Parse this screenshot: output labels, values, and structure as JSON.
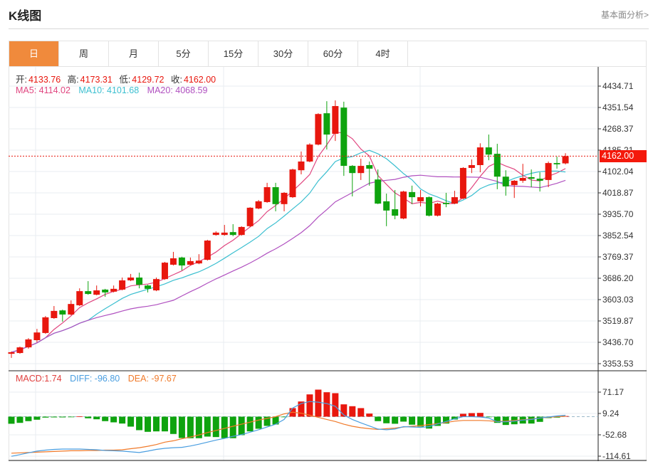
{
  "header": {
    "title": "K线图",
    "link": "基本面分析>"
  },
  "tabs": [
    {
      "label": "日",
      "active": true
    },
    {
      "label": "周"
    },
    {
      "label": "月"
    },
    {
      "label": "5分"
    },
    {
      "label": "15分"
    },
    {
      "label": "30分"
    },
    {
      "label": "60分"
    },
    {
      "label": "4时"
    }
  ],
  "legend": {
    "open_label": "开:",
    "open": "4133.76",
    "high_label": "高:",
    "high": "4173.31",
    "low_label": "低:",
    "low": "4129.72",
    "close_label": "收:",
    "close": "4162.00",
    "ma5": "MA5: 4114.02",
    "ma10": "MA10: 4101.68",
    "ma20": "MA20: 4068.59"
  },
  "macd_legend": {
    "macd": "MACD:1.74",
    "diff": "DIFF: -96.80",
    "dea": "DEA: -97.67"
  },
  "current_price": "4162.00",
  "colors": {
    "up": "#e8170e",
    "down": "#0ea30e",
    "ma5": "#e0457f",
    "ma10": "#3bbfd0",
    "ma20": "#b050c0",
    "diff": "#4a9ee0",
    "dea": "#f07a2a",
    "active_tab": "#f08a3c"
  },
  "chart_data": [
    {
      "type": "candlestick",
      "yticks": [
        "4434.71",
        "4351.54",
        "4268.37",
        "4185.21",
        "4102.04",
        "4018.87",
        "3935.70",
        "3852.54",
        "3769.37",
        "3686.20",
        "3603.03",
        "3519.87",
        "3436.70",
        "3353.53"
      ],
      "ylim": [
        3353.53,
        4434.71
      ],
      "ohlc": [
        [
          3392,
          3401,
          3376,
          3398
        ],
        [
          3395,
          3420,
          3392,
          3417
        ],
        [
          3417,
          3453,
          3412,
          3448
        ],
        [
          3445,
          3489,
          3437,
          3475
        ],
        [
          3473,
          3539,
          3470,
          3534
        ],
        [
          3531,
          3578,
          3528,
          3559
        ],
        [
          3561,
          3564,
          3517,
          3545
        ],
        [
          3545,
          3600,
          3542,
          3586
        ],
        [
          3581,
          3647,
          3578,
          3636
        ],
        [
          3636,
          3675,
          3622,
          3625
        ],
        [
          3622,
          3658,
          3620,
          3639
        ],
        [
          3642,
          3645,
          3614,
          3631
        ],
        [
          3634,
          3658,
          3631,
          3645
        ],
        [
          3642,
          3689,
          3639,
          3678
        ],
        [
          3678,
          3703,
          3675,
          3689
        ],
        [
          3689,
          3708,
          3647,
          3661
        ],
        [
          3658,
          3661,
          3631,
          3645
        ],
        [
          3639,
          3689,
          3636,
          3683
        ],
        [
          3683,
          3750,
          3680,
          3747
        ],
        [
          3739,
          3789,
          3736,
          3764
        ],
        [
          3767,
          3770,
          3717,
          3736
        ],
        [
          3739,
          3767,
          3736,
          3753
        ],
        [
          3744,
          3780,
          3741,
          3755
        ],
        [
          3758,
          3836,
          3755,
          3833
        ],
        [
          3855,
          3869,
          3852,
          3864
        ],
        [
          3855,
          3894,
          3852,
          3864
        ],
        [
          3866,
          3897,
          3850,
          3855
        ],
        [
          3855,
          3889,
          3852,
          3886
        ],
        [
          3889,
          3963,
          3886,
          3961
        ],
        [
          3958,
          3991,
          3955,
          3986
        ],
        [
          3983,
          4058,
          3980,
          4041
        ],
        [
          4041,
          4058,
          3947,
          3975
        ],
        [
          3975,
          4022,
          3947,
          4019
        ],
        [
          4002,
          4113,
          3999,
          4110
        ],
        [
          4107,
          4180,
          4091,
          4141
        ],
        [
          4141,
          4212,
          4138,
          4207
        ],
        [
          4207,
          4329,
          4204,
          4326
        ],
        [
          4329,
          4376,
          4188,
          4246
        ],
        [
          4249,
          4379,
          4221,
          4357
        ],
        [
          4351,
          4374,
          4085,
          4124
        ],
        [
          4124,
          4127,
          4005,
          4096
        ],
        [
          4096,
          4152,
          4069,
          4124
        ],
        [
          4127,
          4141,
          4047,
          4113
        ],
        [
          4071,
          4110,
          3975,
          3977
        ],
        [
          3986,
          4016,
          3889,
          3950
        ],
        [
          3955,
          4030,
          3916,
          3930
        ],
        [
          3919,
          4027,
          3916,
          4024
        ],
        [
          4022,
          4047,
          3975,
          4002
        ],
        [
          3986,
          4030,
          3966,
          4002
        ],
        [
          4002,
          4005,
          3927,
          3930
        ],
        [
          3930,
          3980,
          3927,
          3977
        ],
        [
          3980,
          4019,
          3963,
          3975
        ],
        [
          3977,
          4027,
          3975,
          4002
        ],
        [
          3997,
          4119,
          3994,
          4116
        ],
        [
          4116,
          4149,
          4096,
          4127
        ],
        [
          4127,
          4212,
          4099,
          4196
        ],
        [
          4196,
          4246,
          4146,
          4168
        ],
        [
          4171,
          4210,
          4033,
          4082
        ],
        [
          4082,
          4107,
          4008,
          4044
        ],
        [
          4049,
          4069,
          3999,
          4066
        ],
        [
          4066,
          4132,
          4058,
          4077
        ],
        [
          4080,
          4110,
          4041,
          4074
        ],
        [
          4074,
          4099,
          4024,
          4066
        ],
        [
          4069,
          4141,
          4041,
          4135
        ],
        [
          4135,
          4160,
          4113,
          4130
        ],
        [
          4133.76,
          4173.31,
          4129.72,
          4162.0
        ]
      ],
      "ma_periods": [
        5,
        10,
        20
      ]
    },
    {
      "type": "bar+line",
      "yticks": [
        "71.17",
        "9.24",
        "-52.68",
        "-114.61"
      ],
      "ylim": [
        -114.61,
        71.17
      ],
      "macd": [
        -20.6,
        -18.0,
        -13.0,
        -8.9,
        -2.7,
        -2.1,
        -2.1,
        -0.6,
        1.0,
        -4.7,
        -7.6,
        -13.0,
        -16.5,
        -20.0,
        -28.9,
        -39.2,
        -44.0,
        -42.7,
        -42.7,
        -50.2,
        -61.9,
        -62.5,
        -62.5,
        -57.8,
        -59.2,
        -62.5,
        -62.5,
        -53.7,
        -42.7,
        -35.1,
        -26.8,
        -22.7,
        -1.0,
        24.8,
        44.0,
        64.6,
        78.4,
        70.8,
        68.1,
        35.7,
        30.3,
        24.8,
        8.9,
        -13.0,
        -19.2,
        -20.6,
        -14.4,
        -23.3,
        -28.9,
        -34.5,
        -26.8,
        -20.0,
        -8.3,
        8.3,
        10.3,
        10.9,
        -1.0,
        -18.0,
        -24.1,
        -22.1,
        -20.0,
        -20.0,
        -15.1,
        -4.1,
        -2.7,
        1.74
      ],
      "diff": [
        -115,
        -110,
        -105,
        -100,
        -97,
        -95,
        -94,
        -94,
        -94,
        -95,
        -96,
        -98,
        -99,
        -100,
        -102,
        -104,
        -100,
        -95,
        -92,
        -90,
        -89,
        -85,
        -80,
        -74,
        -68,
        -63,
        -57,
        -52,
        -45,
        -38,
        -30,
        -22,
        -8,
        25,
        38,
        44,
        42,
        38,
        30,
        5,
        -8,
        -18,
        -27,
        -36,
        -38,
        -36,
        -29,
        -30,
        -31,
        -29,
        -21,
        -14,
        -6,
        0,
        0,
        -1,
        -4,
        -15,
        -15,
        -13,
        -10,
        -8,
        -4,
        -1,
        2,
        4
      ],
      "dea": [
        -106,
        -105,
        -104,
        -103,
        -102,
        -101,
        -100,
        -99,
        -99,
        -98,
        -98,
        -97,
        -97,
        -96,
        -93,
        -90,
        -86,
        -81,
        -74,
        -70,
        -64,
        -59,
        -53,
        -46,
        -40,
        -34,
        -28,
        -22,
        -16,
        -10,
        -5,
        0,
        8,
        13,
        10,
        4,
        -2,
        -8,
        -14,
        -22,
        -28,
        -32,
        -35,
        -37,
        -35,
        -33,
        -30,
        -28,
        -26,
        -23,
        -20,
        -17,
        -13,
        -11,
        -11,
        -11,
        -12,
        -14,
        -13,
        -11,
        -9,
        -7,
        -4,
        -2,
        0,
        1
      ]
    }
  ]
}
